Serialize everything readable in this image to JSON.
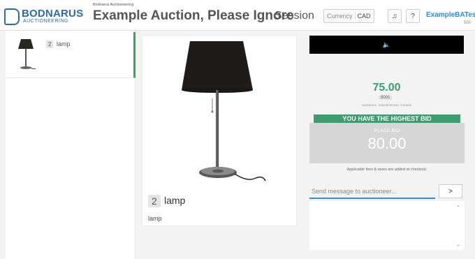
{
  "header": {
    "logo_text": "BODNARUS",
    "logo_sub": "AUCTIONEERING",
    "house_label": "Bodnarus Auctioneering",
    "title": "Example Auction, Please Ignore",
    "session_label": "Session",
    "currency_label": "Currency",
    "currency_value": "CAD",
    "music_icon": "music-note-icon",
    "help_label": "?",
    "username": "ExampleBATest",
    "user_id": "500"
  },
  "sidebar": {
    "items": [
      {
        "lot_number": "2",
        "name": "lamp",
        "thumb_icon": "lamp-thumbnail"
      }
    ]
  },
  "lot": {
    "number": "2",
    "name": "lamp",
    "description": "lamp"
  },
  "bidding": {
    "speaker_icon": "speaker-icon",
    "current_bid": "75.00",
    "paddle": "5001",
    "location": "Saskatoon, Saskatchewan, Canada",
    "status": "YOU HAVE THE HIGHEST BID",
    "place_bid_label": "PLACE BID",
    "place_bid_amount": "80.00",
    "fees_note": "Applicable fees & taxes are added at checkout."
  },
  "chat": {
    "placeholder": "Send message to auctioneer...",
    "send_label": ">"
  },
  "colors": {
    "brand_blue": "#2d6aa8",
    "accent_green": "#3a9e6f",
    "link_blue": "#2d8be0",
    "video_bg": "#000000"
  }
}
